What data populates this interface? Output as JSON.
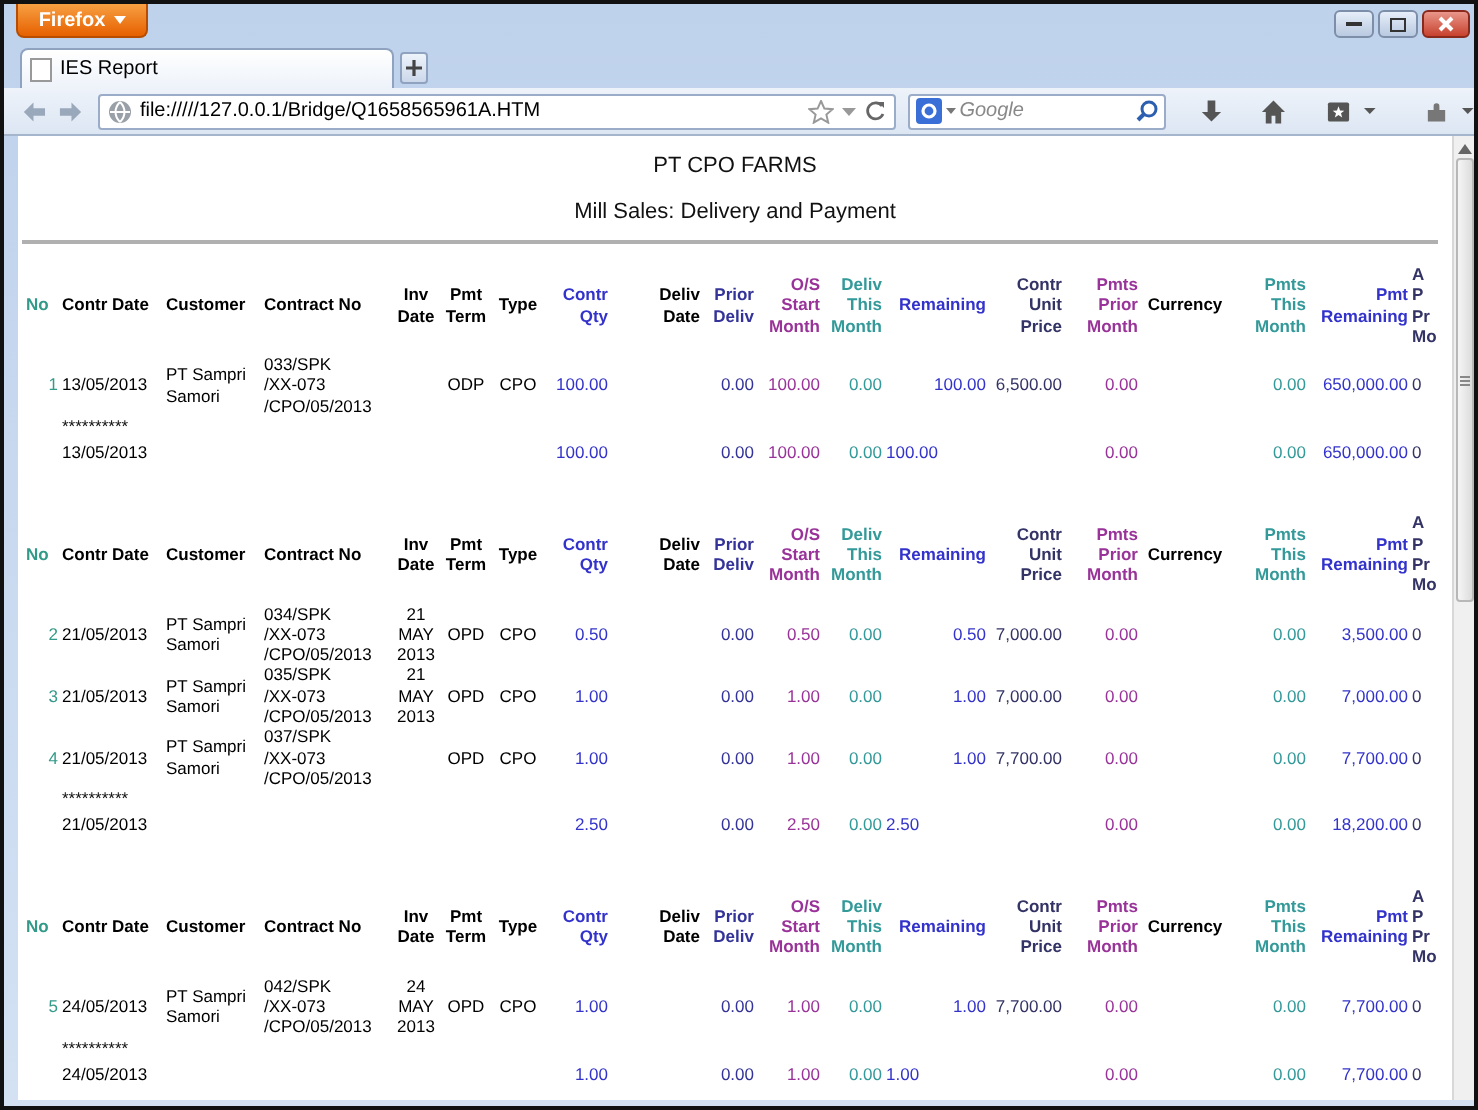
{
  "browser": {
    "app_button": "Firefox",
    "tabs": [
      {
        "title": "IES Report",
        "selected": true
      }
    ],
    "url": "file://///127.0.0.1/Bridge/Q1658565961A.HTM",
    "search": {
      "placeholder": "Google"
    }
  },
  "report": {
    "company": "PT CPO FARMS",
    "title": "Mill Sales: Delivery and Payment"
  },
  "columns": [
    {
      "color": "#339988"
    },
    {
      "color": "#000000"
    },
    {
      "color": "#000000"
    },
    {
      "color": "#000000"
    },
    {
      "color": "#000000"
    },
    {
      "color": "#000000"
    },
    {
      "color": "#000000"
    },
    {
      "color": "#3333cc"
    },
    {
      "color": "#000000"
    },
    {
      "color": "#333399"
    },
    {
      "color": "#993399"
    },
    {
      "color": "#339999"
    },
    {
      "color": "#3333cc"
    },
    {
      "color": "#333366"
    },
    {
      "color": "#993399"
    },
    {
      "color": "#000000"
    },
    {
      "color": "#339999"
    },
    {
      "color": "#3333cc"
    },
    {
      "color": "#333366"
    }
  ],
  "groups": [
    {
      "header": [
        "No",
        "Contr Date",
        "Customer",
        "Contract No",
        "Inv\nDate",
        "Pmt\nTerm",
        "Type",
        "Contr\nQty",
        "Deliv\nDate",
        "Prior\nDeliv",
        "O/S\nStart\nMonth",
        "Deliv\nThis\nMonth",
        "Remaining",
        "Contr\nUnit\nPrice",
        "Pmts\nPrior\nMonth",
        "Currency",
        "Pmts\nThis\nMonth",
        "Pmt\nRemaining",
        "A\nP\nPr\nMo"
      ],
      "rows": [
        {
          "no": "1",
          "contr_date": "13/05/2013",
          "customer": "PT Sampri\nSamori",
          "contract_no": "033/SPK\n/XX-073\n/CPO/05/2013",
          "pmt_term": "ODP",
          "type": "CPO",
          "contr_qty": "100.00",
          "prior_deliv": "0.00",
          "os_start_month": "100.00",
          "deliv_this_month": "0.00",
          "remaining": "100.00",
          "contr_unit_price": "6,500.00",
          "pmts_prior_month": "0.00",
          "pmts_this_month": "0.00",
          "pmt_remaining": "650,000.00",
          "column_19": "0"
        }
      ],
      "separator": "**********",
      "total": {
        "contr_date": "13/05/2013",
        "contr_qty": "100.00",
        "prior_deliv": "0.00",
        "os_start_month": "100.00",
        "deliv_this_month": "0.00",
        "remaining": "100.00",
        "pmts_prior_month": "0.00",
        "pmts_this_month": "0.00",
        "pmt_remaining": "650,000.00",
        "column_19": "0"
      }
    },
    {
      "header": [
        "No",
        "Contr Date",
        "Customer",
        "Contract No",
        "Inv\nDate",
        "Pmt\nTerm",
        "Type",
        "Contr\nQty",
        "Deliv\nDate",
        "Prior\nDeliv",
        "O/S\nStart\nMonth",
        "Deliv\nThis\nMonth",
        "Remaining",
        "Contr\nUnit\nPrice",
        "Pmts\nPrior\nMonth",
        "Currency",
        "Pmts\nThis\nMonth",
        "Pmt\nRemaining",
        "A\nP\nPr\nMo"
      ],
      "rows": [
        {
          "no": "2",
          "contr_date": "21/05/2013",
          "customer": "PT Sampri\nSamori",
          "contract_no": "034/SPK\n/XX-073\n/CPO/05/2013",
          "inv_date": "21\nMAY\n2013",
          "pmt_term": "OPD",
          "type": "CPO",
          "contr_qty": "0.50",
          "prior_deliv": "0.00",
          "os_start_month": "0.50",
          "deliv_this_month": "0.00",
          "remaining": "0.50",
          "contr_unit_price": "7,000.00",
          "pmts_prior_month": "0.00",
          "pmts_this_month": "0.00",
          "pmt_remaining": "3,500.00",
          "column_19": "0"
        },
        {
          "no": "3",
          "contr_date": "21/05/2013",
          "customer": "PT Sampri\nSamori",
          "contract_no": "035/SPK\n/XX-073\n/CPO/05/2013",
          "inv_date": "21\nMAY\n2013",
          "pmt_term": "OPD",
          "type": "CPO",
          "contr_qty": "1.00",
          "prior_deliv": "0.00",
          "os_start_month": "1.00",
          "deliv_this_month": "0.00",
          "remaining": "1.00",
          "contr_unit_price": "7,000.00",
          "pmts_prior_month": "0.00",
          "pmts_this_month": "0.00",
          "pmt_remaining": "7,000.00",
          "column_19": "0"
        },
        {
          "no": "4",
          "contr_date": "21/05/2013",
          "customer": "PT Sampri\nSamori",
          "contract_no": "037/SPK\n/XX-073\n/CPO/05/2013",
          "pmt_term": "OPD",
          "type": "CPO",
          "contr_qty": "1.00",
          "prior_deliv": "0.00",
          "os_start_month": "1.00",
          "deliv_this_month": "0.00",
          "remaining": "1.00",
          "contr_unit_price": "7,700.00",
          "pmts_prior_month": "0.00",
          "pmts_this_month": "0.00",
          "pmt_remaining": "7,700.00",
          "column_19": "0"
        }
      ],
      "separator": "**********",
      "total": {
        "contr_date": "21/05/2013",
        "contr_qty": "2.50",
        "prior_deliv": "0.00",
        "os_start_month": "2.50",
        "deliv_this_month": "0.00",
        "remaining": "2.50",
        "pmts_prior_month": "0.00",
        "pmts_this_month": "0.00",
        "pmt_remaining": "18,200.00",
        "column_19": "0"
      }
    },
    {
      "header": [
        "No",
        "Contr Date",
        "Customer",
        "Contract No",
        "Inv\nDate",
        "Pmt\nTerm",
        "Type",
        "Contr\nQty",
        "Deliv\nDate",
        "Prior\nDeliv",
        "O/S\nStart\nMonth",
        "Deliv\nThis\nMonth",
        "Remaining",
        "Contr\nUnit\nPrice",
        "Pmts\nPrior\nMonth",
        "Currency",
        "Pmts\nThis\nMonth",
        "Pmt\nRemaining",
        "A\nP\nPr\nMo"
      ],
      "rows": [
        {
          "no": "5",
          "contr_date": "24/05/2013",
          "customer": "PT Sampri\nSamori",
          "contract_no": "042/SPK\n/XX-073\n/CPO/05/2013",
          "inv_date": "24\nMAY\n2013",
          "pmt_term": "OPD",
          "type": "CPO",
          "contr_qty": "1.00",
          "prior_deliv": "0.00",
          "os_start_month": "1.00",
          "deliv_this_month": "0.00",
          "remaining": "1.00",
          "contr_unit_price": "7,700.00",
          "pmts_prior_month": "0.00",
          "pmts_this_month": "0.00",
          "pmt_remaining": "7,700.00",
          "column_19": "0"
        }
      ],
      "separator": "**********",
      "total": {
        "contr_date": "24/05/2013",
        "contr_qty": "1.00",
        "prior_deliv": "0.00",
        "os_start_month": "1.00",
        "deliv_this_month": "0.00",
        "remaining": "1.00",
        "pmts_prior_month": "0.00",
        "pmts_this_month": "0.00",
        "pmt_remaining": "7,700.00",
        "column_19": "0"
      }
    }
  ]
}
